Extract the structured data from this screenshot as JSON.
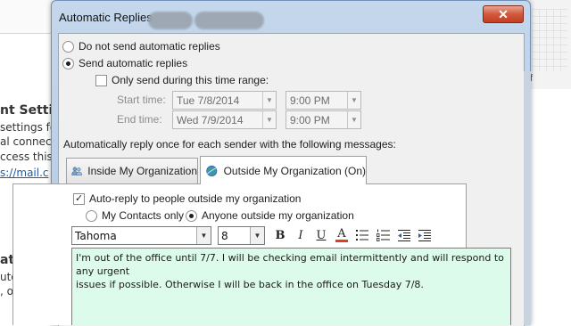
{
  "background_window": {
    "heading1": "nt Settings",
    "line1": "settings fo",
    "line2": "al connect",
    "line3": "ccess this ac",
    "link": "s://mail.c",
    "heading2": "atic Replie",
    "line4": "utomatic repl",
    "line5": ", or not ava",
    "right_label": "f"
  },
  "dialog": {
    "title": "Automatic Replies",
    "close_label": "✕",
    "no_replies_label": "Do not send automatic replies",
    "send_replies_label": "Send automatic replies",
    "time_range_label": "Only send during this time range:",
    "start_time_label": "Start time:",
    "start_date": "Tue 7/8/2014",
    "start_time": "9:00 PM",
    "end_time_label": "End time:",
    "end_date": "Wed 7/9/2014",
    "end_time": "9:00 PM",
    "reply_once_label": "Automatically reply once for each sender with the following messages:",
    "tabs": [
      {
        "label": "Inside My Organization",
        "active": false
      },
      {
        "label": "Outside My Organization (On)",
        "active": true
      }
    ],
    "outside": {
      "auto_reply_label": "Auto-reply to people outside my organization",
      "contacts_only_label": "My Contacts only",
      "anyone_label": "Anyone outside my organization",
      "font_name": "Tahoma",
      "font_size": "8",
      "bold": "B",
      "italic": "I",
      "underline": "U",
      "font_color": "A",
      "message": "I'm out of the office until 7/7. I will be checking email intermittently and will respond to any urgent\nissues if possible. Otherwise I will be back in the office on Tuesday 7/8."
    }
  },
  "colors": {
    "message_bg": "#ddfbeb",
    "close_red": "#c23f21",
    "font_color_underline": "#e0401b"
  }
}
